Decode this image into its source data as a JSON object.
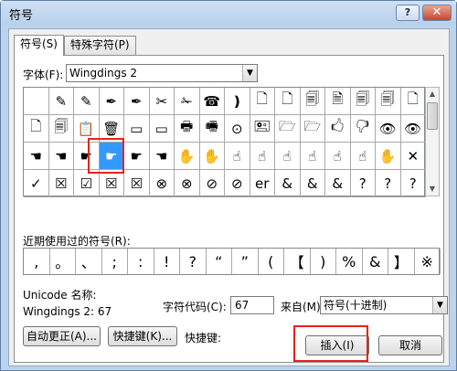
{
  "window": {
    "title": "符号",
    "help": "?",
    "close": "✕"
  },
  "tabs": [
    {
      "label": "符号(S)"
    },
    {
      "label": "特殊字符(P)"
    }
  ],
  "font": {
    "label": "字体(F):",
    "value": "Wingdings 2"
  },
  "symbol_grid": [
    [
      "",
      "✎",
      "✎",
      "✒",
      "✒",
      "✂",
      "✁",
      "☎",
      "❫",
      "🗋",
      "🗋",
      "🗐",
      "🗎",
      "🗐",
      "🗐",
      "🗋"
    ],
    [
      "🗋",
      "🗐",
      "📋",
      "🗑",
      "▭",
      "▭",
      "🖶",
      "🖷",
      "⊙",
      "🖭",
      "🗁",
      "🗁",
      "🖒",
      "🖓",
      "👁",
      "👁"
    ],
    [
      "☚",
      "☚",
      "☛",
      "☛",
      "☛",
      "☚",
      "✋",
      "✋",
      "☝",
      "☝",
      "☝",
      "☝",
      "☝",
      "☝",
      "✋",
      "✕"
    ],
    [
      "✓",
      "☒",
      "☑",
      "☒",
      "☒",
      "⊗",
      "⊗",
      "⊘",
      "⊘",
      "er",
      "&",
      "&",
      "&",
      "?",
      "?",
      "?"
    ]
  ],
  "selected": {
    "row": 2,
    "col": 3
  },
  "recent": {
    "label": "近期使用过的符号(R):",
    "symbols": [
      ",",
      "。",
      "、",
      ";",
      ":",
      "!",
      "?",
      "“",
      "”",
      "(",
      "【",
      ")",
      "%",
      "&",
      "】",
      "※"
    ]
  },
  "unicode_label": "Unicode 名称:",
  "char_name": "Wingdings 2: 67",
  "charcode": {
    "label": "字符代码(C):",
    "value": "67"
  },
  "from": {
    "label": "来自(M):",
    "value": "符号(十进制)"
  },
  "buttons": {
    "autocorrect": "自动更正(A)...",
    "shortcut_key": "快捷键(K)...",
    "shortcut_label": "快捷键:",
    "insert": "插入(I)",
    "cancel": "取消"
  }
}
